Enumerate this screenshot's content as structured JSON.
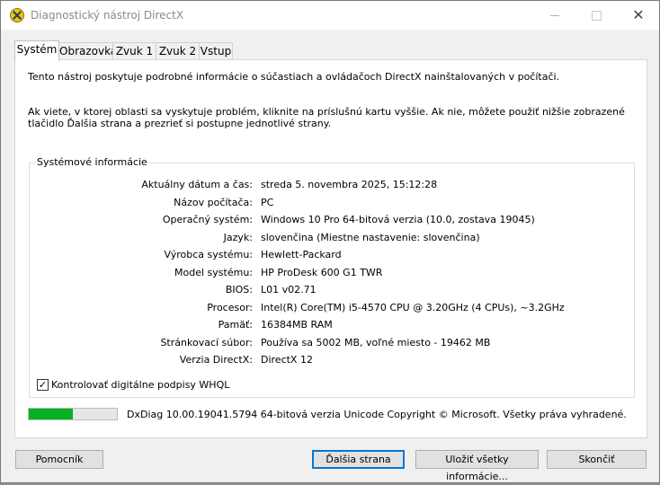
{
  "window": {
    "title": "Diagnostický nástroj DirectX",
    "minimize_label": "",
    "maximize_label": "",
    "close_label": "✕"
  },
  "tabs": [
    {
      "label": "Systém",
      "active": true
    },
    {
      "label": "Obrazovka",
      "active": false
    },
    {
      "label": "Zvuk 1",
      "active": false
    },
    {
      "label": "Zvuk 2",
      "active": false
    },
    {
      "label": "Vstup",
      "active": false
    }
  ],
  "intro": {
    "line1": "Tento nástroj poskytuje podrobné informácie o súčastiach a ovládačoch DirectX nainštalovaných v počítači.",
    "line2": "Ak viete, v ktorej oblasti sa vyskytuje problém, kliknite na príslušnú kartu vyššie. Ak nie, môžete použiť nižšie zobrazené tlačidlo Ďalšia strana a prezrieť si postupne jednotlivé strany."
  },
  "system_info": {
    "title": "Systémové informácie",
    "rows": [
      {
        "label": "Aktuálny dátum a čas:",
        "value": "streda 5. novembra 2025, 15:12:28"
      },
      {
        "label": "Názov počítača:",
        "value": "PC"
      },
      {
        "label": "Operačný systém:",
        "value": "Windows 10 Pro 64-bitová verzia (10.0, zostava 19045)"
      },
      {
        "label": "Jazyk:",
        "value": "slovenčina (Miestne nastavenie: slovenčina)"
      },
      {
        "label": "Výrobca systému:",
        "value": "Hewlett-Packard"
      },
      {
        "label": "Model systému:",
        "value": "HP ProDesk 600 G1 TWR"
      },
      {
        "label": "BIOS:",
        "value": "L01 v02.71"
      },
      {
        "label": "Procesor:",
        "value": "Intel(R) Core(TM) i5-4570 CPU @ 3.20GHz (4 CPUs), ~3.2GHz"
      },
      {
        "label": "Pamäť:",
        "value": "16384MB RAM"
      },
      {
        "label": "Stránkovací súbor:",
        "value": "Používa sa 5002 MB, voľné miesto - 19462 MB"
      },
      {
        "label": "Verzia DirectX:",
        "value": "DirectX 12"
      }
    ]
  },
  "whql_checkbox": {
    "label": "Kontrolovať digitálne podpisy WHQL",
    "checked": true,
    "mark": "✓"
  },
  "status": {
    "progress_fraction": 0.5,
    "progress_color": "#06b025",
    "text": "DxDiag 10.00.19041.5794 64-bitová verzia Unicode  Copyright © Microsoft. Všetky práva vyhradené."
  },
  "buttons": {
    "help": "Pomocník",
    "next_page": "Ďalšia strana",
    "save_all": "Uložiť všetky informácie...",
    "exit": "Skončiť"
  }
}
